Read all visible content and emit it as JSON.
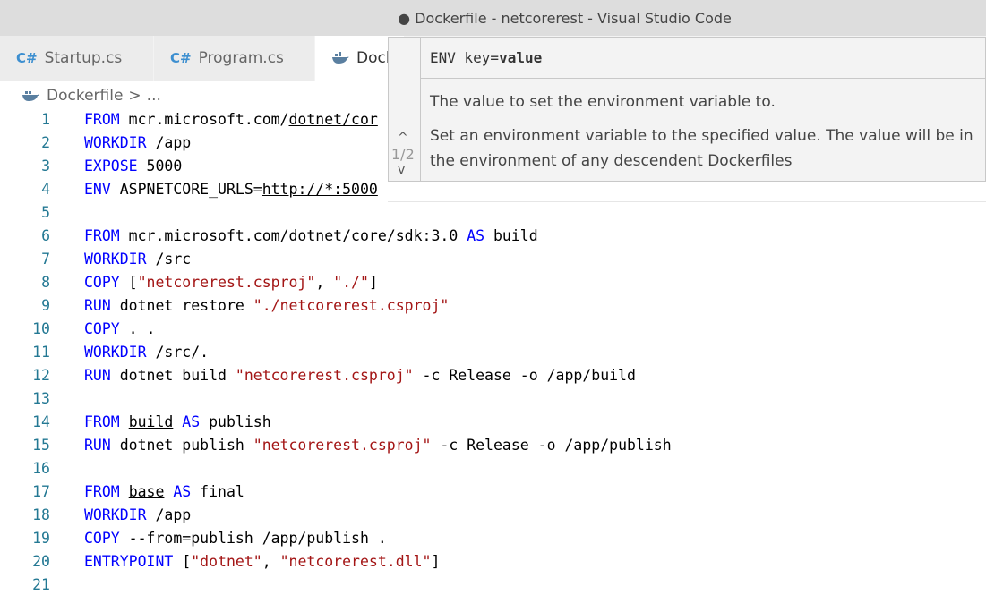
{
  "window": {
    "title": "● Dockerfile - netcorerest - Visual Studio Code"
  },
  "tabs": [
    {
      "label": "Startup.cs",
      "icon": "csharp-icon"
    },
    {
      "label": "Program.cs",
      "icon": "csharp-icon"
    },
    {
      "label": "Dockerfile",
      "icon": "docker-icon",
      "visible": "Dock"
    }
  ],
  "breadcrumb": {
    "file": "Dockerfile",
    "separator": ">",
    "more": "..."
  },
  "hover": {
    "signature_prefix": "ENV key=",
    "signature_param": "value",
    "param_doc": "The value to set the environment variable to.",
    "description": "Set an environment variable to the specified value. The value will be in the environment of any descendent Dockerfiles",
    "counter": "1/2",
    "up": "^",
    "down": "v"
  },
  "code_lines": [
    {
      "n": "1"
    },
    {
      "n": "2"
    },
    {
      "n": "3"
    },
    {
      "n": "4"
    },
    {
      "n": "5"
    },
    {
      "n": "6"
    },
    {
      "n": "7"
    },
    {
      "n": "8"
    },
    {
      "n": "9"
    },
    {
      "n": "10"
    },
    {
      "n": "11"
    },
    {
      "n": "12"
    },
    {
      "n": "13"
    },
    {
      "n": "14"
    },
    {
      "n": "15"
    },
    {
      "n": "16"
    },
    {
      "n": "17"
    },
    {
      "n": "18"
    },
    {
      "n": "19"
    },
    {
      "n": "20"
    },
    {
      "n": "21"
    }
  ],
  "code": {
    "l1": [
      "FROM",
      " mcr.microsoft.com/",
      "dotnet/cor"
    ],
    "l2": [
      "WORKDIR",
      " /app"
    ],
    "l3": [
      "EXPOSE",
      " 5000"
    ],
    "l4": [
      "ENV",
      " ASPNETCORE_URLS=",
      "http://*:5000"
    ],
    "l6": [
      "FROM",
      " mcr.microsoft.com/",
      "dotnet/core/sdk",
      ":3.0 ",
      "AS",
      " build"
    ],
    "l7": [
      "WORKDIR",
      " /src"
    ],
    "l8": [
      "COPY",
      " [",
      "\"netcorerest.csproj\"",
      ", ",
      "\"./\"",
      "]"
    ],
    "l9": [
      "RUN",
      " dotnet restore ",
      "\"./netcorerest.csproj\""
    ],
    "l10": [
      "COPY",
      " . ."
    ],
    "l11": [
      "WORKDIR",
      " /src/."
    ],
    "l12": [
      "RUN",
      " dotnet build ",
      "\"netcorerest.csproj\"",
      " -c Release -o /app/build"
    ],
    "l14": [
      "FROM",
      " ",
      "build",
      " ",
      "AS",
      " publish"
    ],
    "l15": [
      "RUN",
      " dotnet publish ",
      "\"netcorerest.csproj\"",
      " -c Release -o /app/publish"
    ],
    "l17": [
      "FROM",
      " ",
      "base",
      " ",
      "AS",
      " final"
    ],
    "l18": [
      "WORKDIR",
      " /app"
    ],
    "l19": [
      "COPY",
      " --from=publish /app/publish ."
    ],
    "l20": [
      "ENTRYPOINT",
      " [",
      "\"dotnet\"",
      ", ",
      "\"netcorerest.dll\"",
      "]"
    ]
  },
  "colors": {
    "keyword": "#0000ff",
    "string": "#a31515",
    "line_number": "#237893"
  }
}
